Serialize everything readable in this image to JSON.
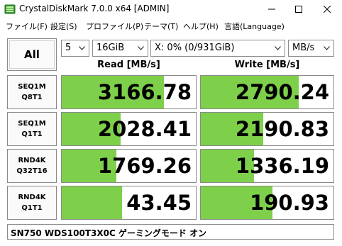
{
  "window": {
    "title": "CrystalDiskMark 7.0.0 x64 [ADMIN]"
  },
  "menu": [
    {
      "label": "ファイル(F)"
    },
    {
      "label": "設定(S)"
    },
    {
      "label": "プロファイル(P)"
    },
    {
      "label": "テーマ(T)"
    },
    {
      "label": "ヘルプ(H)"
    },
    {
      "label": "言語(Language)"
    }
  ],
  "controls": {
    "all_label": "All",
    "count_value": "5",
    "size_value": "16GiB",
    "drive_value": "X: 0% (0/931GiB)",
    "unit_value": "MB/s"
  },
  "headers": {
    "read": "Read [MB/s]",
    "write": "Write [MB/s]"
  },
  "rows": [
    {
      "line1": "SEQ1M",
      "line2": "Q8T1",
      "read": "3166.78",
      "write": "2790.24",
      "read_fill": 0.76,
      "write_fill": 0.74
    },
    {
      "line1": "SEQ1M",
      "line2": "Q1T1",
      "read": "2028.41",
      "write": "2190.83",
      "read_fill": 0.44,
      "write_fill": 0.47
    },
    {
      "line1": "RND4K",
      "line2": "Q32T16",
      "read": "1769.26",
      "write": "1336.19",
      "read_fill": 0.41,
      "write_fill": 0.4
    },
    {
      "line1": "RND4K",
      "line2": "Q1T1",
      "read": "43.45",
      "write": "190.93",
      "read_fill": 0.45,
      "write_fill": 0.54
    }
  ],
  "status": {
    "text": "SN750 WDS100T3X0C ゲーミングモード オン"
  },
  "colors": {
    "bar_green": "#7ed04b",
    "border": "#8a8a8a"
  }
}
